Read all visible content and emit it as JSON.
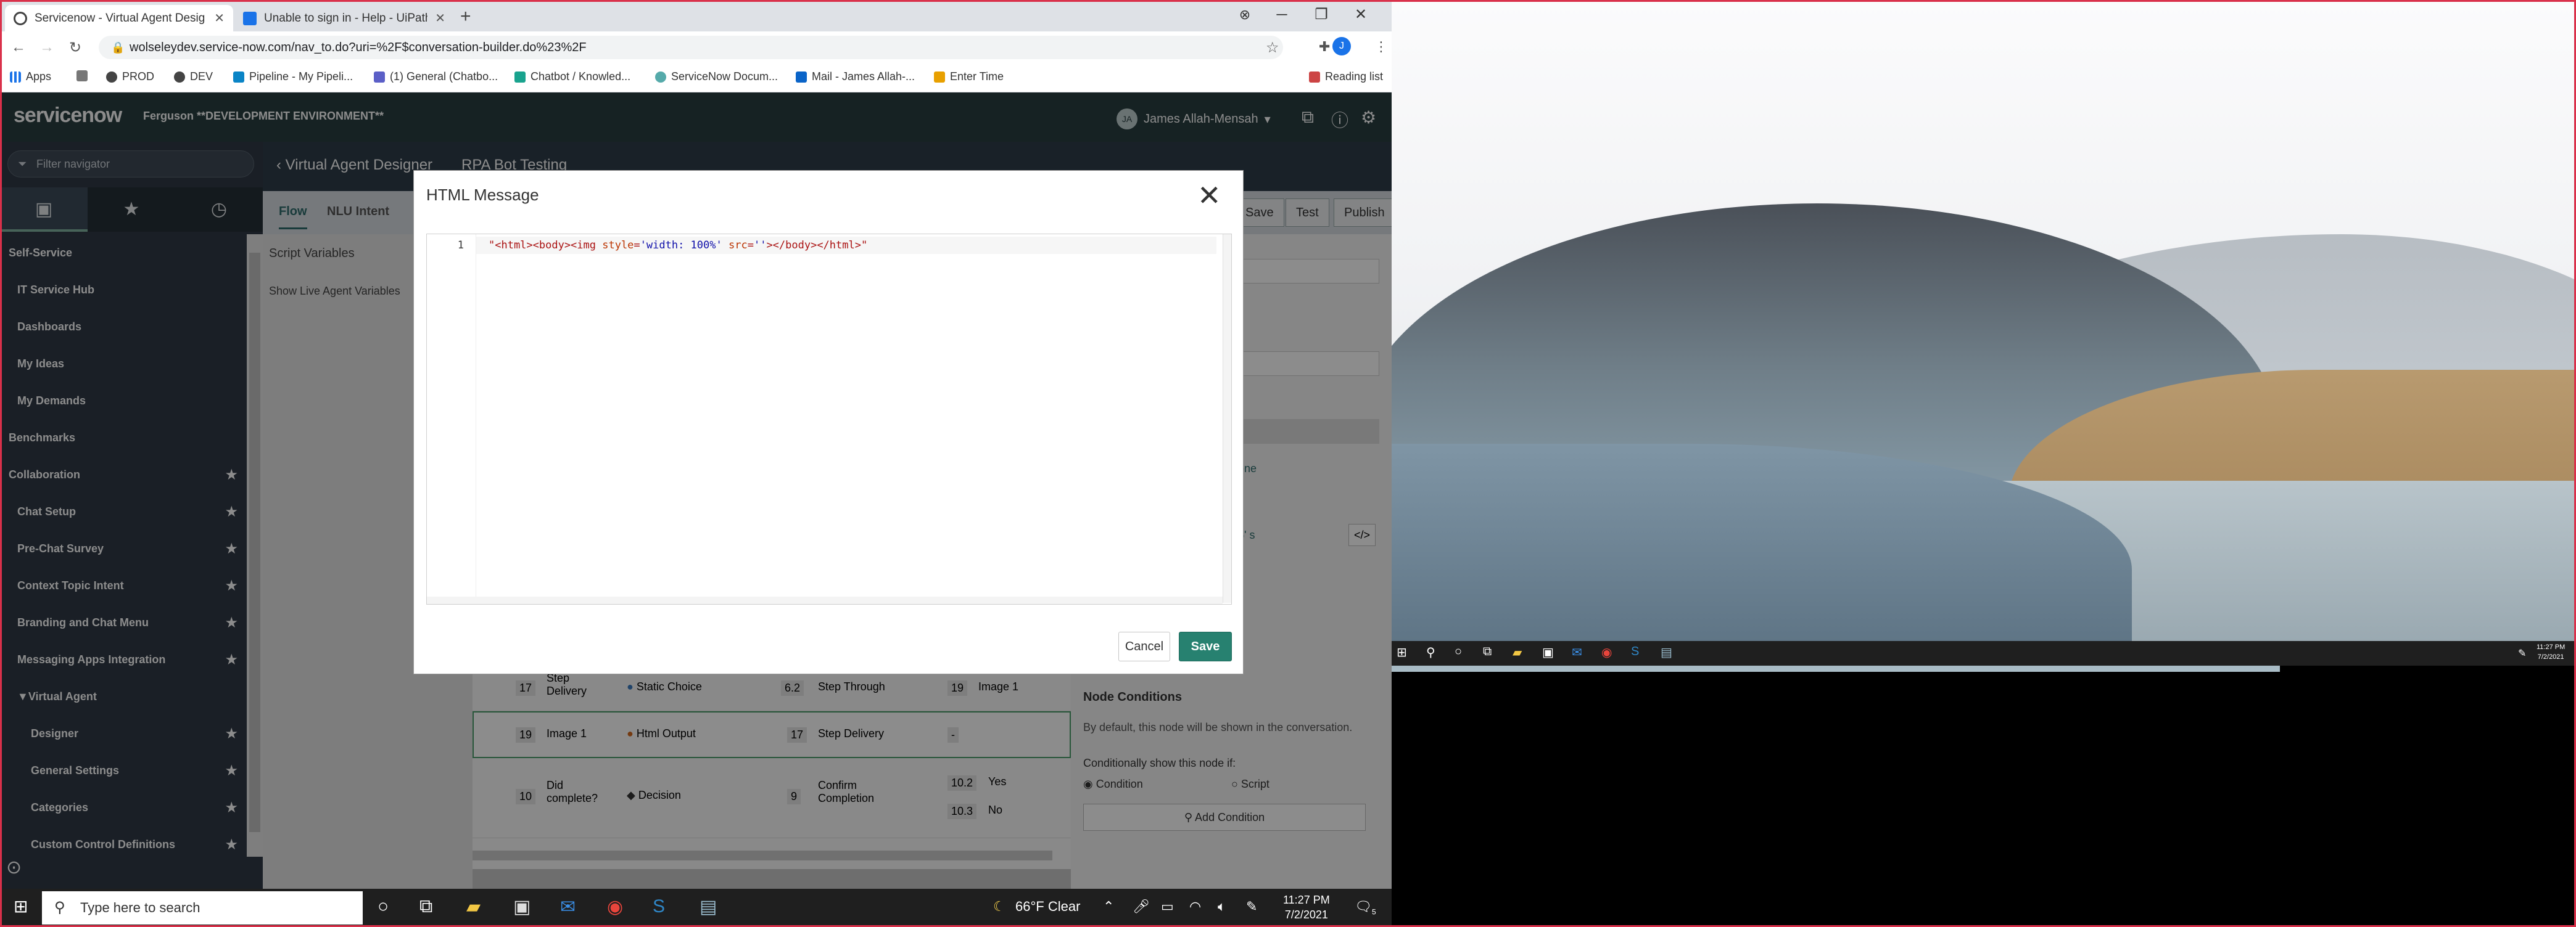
{
  "browser": {
    "tabs": [
      {
        "title": "Servicenow - Virtual Agent Desig",
        "active": true
      },
      {
        "title": "Unable to sign in - Help - UiPath",
        "active": false
      }
    ],
    "url": "wolseleydev.service-now.com/nav_to.do?uri=%2F$conversation-builder.do%23%2F",
    "bookmarks": [
      "Apps",
      "PROD",
      "DEV",
      "Pipeline - My Pipeli...",
      "(1) General (Chatbo...",
      "Chatbot / Knowled...",
      "ServiceNow Docum...",
      "Mail - James Allah-...",
      "Enter Time"
    ],
    "reading_list": "Reading list"
  },
  "servicenow": {
    "logo": "servicenow",
    "instance": "Ferguson **DEVELOPMENT ENVIRONMENT**",
    "user_initials": "JA",
    "user_name": "James Allah-Mensah"
  },
  "sidebar": {
    "filter_placeholder": "Filter navigator",
    "items": [
      {
        "label": "Self-Service",
        "level": 0,
        "star": false
      },
      {
        "label": "IT Service Hub",
        "level": 1,
        "star": false
      },
      {
        "label": "Dashboards",
        "level": 1,
        "star": false
      },
      {
        "label": "My Ideas",
        "level": 1,
        "star": false
      },
      {
        "label": "My Demands",
        "level": 1,
        "star": false
      },
      {
        "label": "Benchmarks",
        "level": 0,
        "star": false
      },
      {
        "label": "Collaboration",
        "level": 0,
        "star": true
      },
      {
        "label": "Chat Setup",
        "level": 1,
        "star": true
      },
      {
        "label": "Pre-Chat Survey",
        "level": 1,
        "star": true
      },
      {
        "label": "Context Topic Intent",
        "level": 1,
        "star": true
      },
      {
        "label": "Branding and Chat Menu",
        "level": 1,
        "star": true
      },
      {
        "label": "Messaging Apps Integration",
        "level": 1,
        "star": true
      },
      {
        "label": "Virtual Agent",
        "level": 1,
        "star": false
      },
      {
        "label": "Designer",
        "level": 2,
        "star": true
      },
      {
        "label": "General Settings",
        "level": 2,
        "star": true
      },
      {
        "label": "Categories",
        "level": 2,
        "star": true
      },
      {
        "label": "Custom Control Definitions",
        "level": 2,
        "star": true
      }
    ]
  },
  "designer": {
    "back_label": "Virtual Agent Designer",
    "topic": "RPA Bot Testing",
    "tabs": [
      "Flow",
      "NLU Intent"
    ],
    "actions": [
      "Save",
      "Test",
      "Publish"
    ],
    "left_labels": [
      "Script Variables",
      "Show Live Agent Variables"
    ],
    "right_snippets": [
      "current one",
      "th: 100%' s"
    ],
    "node_conditions": {
      "title": "Node Conditions",
      "desc": "By default, this node will be shown in the conversation.",
      "cond_label": "Conditionally show this node if:",
      "opt1": "Condition",
      "opt2": "Script",
      "add": "Add Condition"
    },
    "rows": [
      {
        "num": "17",
        "name": "Step Delivery",
        "type": "Static Choice",
        "next_num": "6.2",
        "next": "Step Through",
        "out_num": "19",
        "out": "Image 1"
      },
      {
        "num": "19",
        "name": "Image 1",
        "type": "Html Output",
        "next_num": "17",
        "next": "Step Delivery",
        "out_num": "-",
        "out": ""
      },
      {
        "num": "10",
        "name": "Did complete?",
        "type": "Decision",
        "next_num": "9",
        "next": "Confirm Completion",
        "out_num": "10.2",
        "out": "Yes",
        "out_num2": "10.3",
        "out2": "No"
      }
    ]
  },
  "modal": {
    "title": "HTML Message",
    "line_number": "1",
    "code": "\"<html><body><img style='width: 100%' src=''></body></html>\"",
    "cancel": "Cancel",
    "save": "Save"
  },
  "taskbar": {
    "search_placeholder": "Type here to search",
    "weather": "66°F  Clear",
    "time": "11:27 PM",
    "date": "7/2/2021",
    "notif_count": "5"
  },
  "taskbar2": {
    "time": "11:27 PM",
    "date": "7/2/2021"
  }
}
